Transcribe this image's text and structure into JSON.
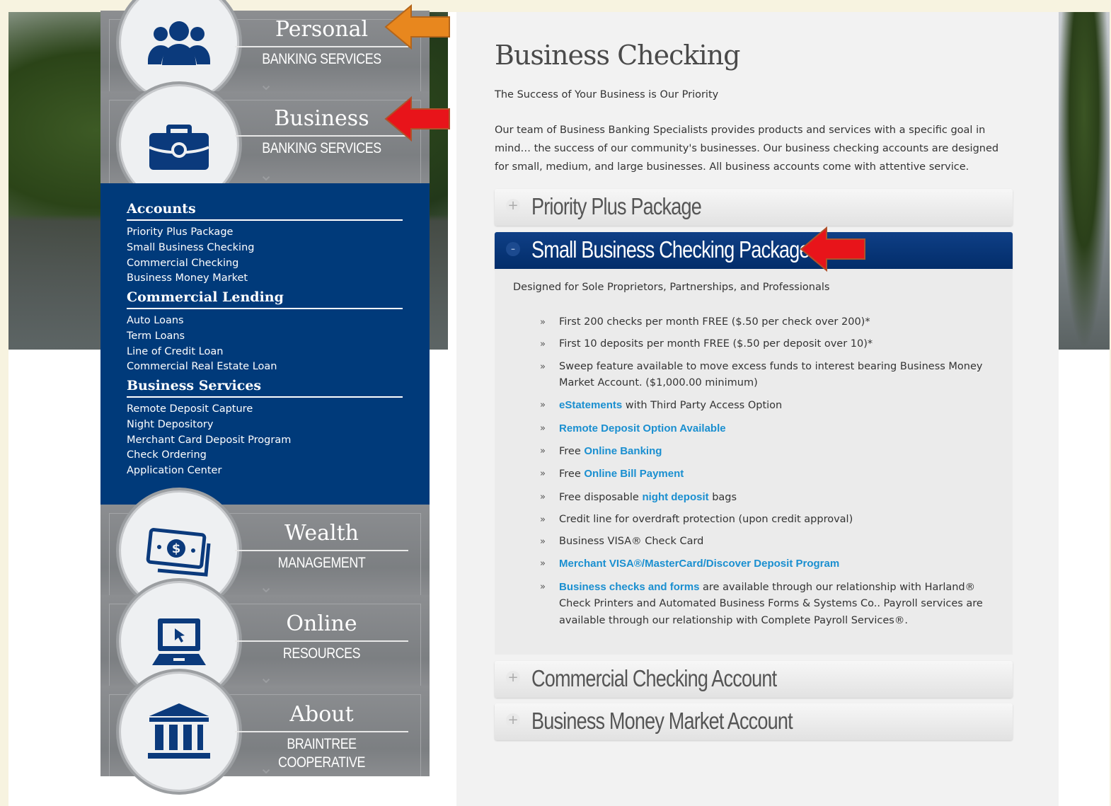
{
  "sidebar": {
    "personal": {
      "title": "Personal",
      "subtitle": "BANKING SERVICES",
      "icon": "people-icon"
    },
    "business": {
      "title": "Business",
      "subtitle": "BANKING SERVICES",
      "icon": "briefcase-icon"
    },
    "wealth": {
      "title": "Wealth",
      "subtitle": "MANAGEMENT",
      "icon": "money-icon"
    },
    "online": {
      "title": "Online",
      "subtitle": "RESOURCES",
      "icon": "laptop-icon"
    },
    "about": {
      "title": "About",
      "subtitle": "BRAINTREE COOPERATIVE",
      "icon": "bank-icon"
    },
    "menu": {
      "accounts": {
        "heading": "Accounts",
        "items": [
          "Priority Plus Package",
          "Small Business Checking",
          "Commercial Checking",
          "Business Money Market"
        ]
      },
      "lending": {
        "heading": "Commercial Lending",
        "items": [
          "Auto Loans",
          "Term Loans",
          "Line of Credit Loan",
          "Commercial Real Estate Loan"
        ]
      },
      "services": {
        "heading": "Business Services",
        "items": [
          "Remote Deposit Capture",
          "Night Depository",
          "Merchant Card Deposit Program",
          "Check Ordering",
          "Application Center"
        ]
      }
    }
  },
  "main": {
    "title": "Business Checking",
    "tagline": "The Success of Your Business is Our Priority",
    "intro": "Our team of Business Banking Specialists provides products and services with a specific goal in mind… the success of our community's businesses. Our business checking accounts are designed for small, medium, and large businesses. All business accounts come with attentive service.",
    "accordion": [
      {
        "label": "Priority Plus Package",
        "toggle": "+"
      },
      {
        "label": "Small Business Checking Package",
        "toggle": "-"
      },
      {
        "label": "Commercial Checking Account",
        "toggle": "+"
      },
      {
        "label": "Business Money Market Account",
        "toggle": "+"
      }
    ],
    "panel": {
      "description": "Designed for Sole Proprietors, Partnerships, and Professionals",
      "bullet": "»",
      "features": [
        {
          "pre": "First 200 checks per month FREE ($.50 per check over 200)*",
          "link": "",
          "post": ""
        },
        {
          "pre": "First 10 deposits per month FREE ($.50 per deposit over 10)*",
          "link": "",
          "post": ""
        },
        {
          "pre": "Sweep feature available to move excess funds to interest bearing Business Money Market Account. ($1,000.00 minimum)",
          "link": "",
          "post": ""
        },
        {
          "pre": "",
          "link": "eStatements",
          "post": " with Third Party Access Option"
        },
        {
          "pre": "",
          "link": "Remote Deposit Option Available",
          "post": ""
        },
        {
          "pre": "Free ",
          "link": "Online Banking",
          "post": ""
        },
        {
          "pre": "Free ",
          "link": "Online Bill Payment",
          "post": ""
        },
        {
          "pre": "Free disposable ",
          "link": "night deposit",
          "post": " bags"
        },
        {
          "pre": "Credit line for overdraft protection (upon credit approval)",
          "link": "",
          "post": ""
        },
        {
          "pre": "Business VISA® Check Card",
          "link": "",
          "post": ""
        },
        {
          "pre": "",
          "link": "Merchant VISA®/MasterCard/Discover Deposit Program",
          "post": ""
        },
        {
          "pre": "",
          "link": "Business checks and forms",
          "post": " are available through our relationship with Harland® Check Printers and Automated Business Forms & Systems Co.. Payroll services are available through our relationship with Complete Payroll Services®."
        }
      ]
    }
  },
  "colors": {
    "brand_blue": "#003a7a",
    "link": "#1a8fd0",
    "arrow_orange": "#e8871e",
    "arrow_red": "#e8141a"
  }
}
